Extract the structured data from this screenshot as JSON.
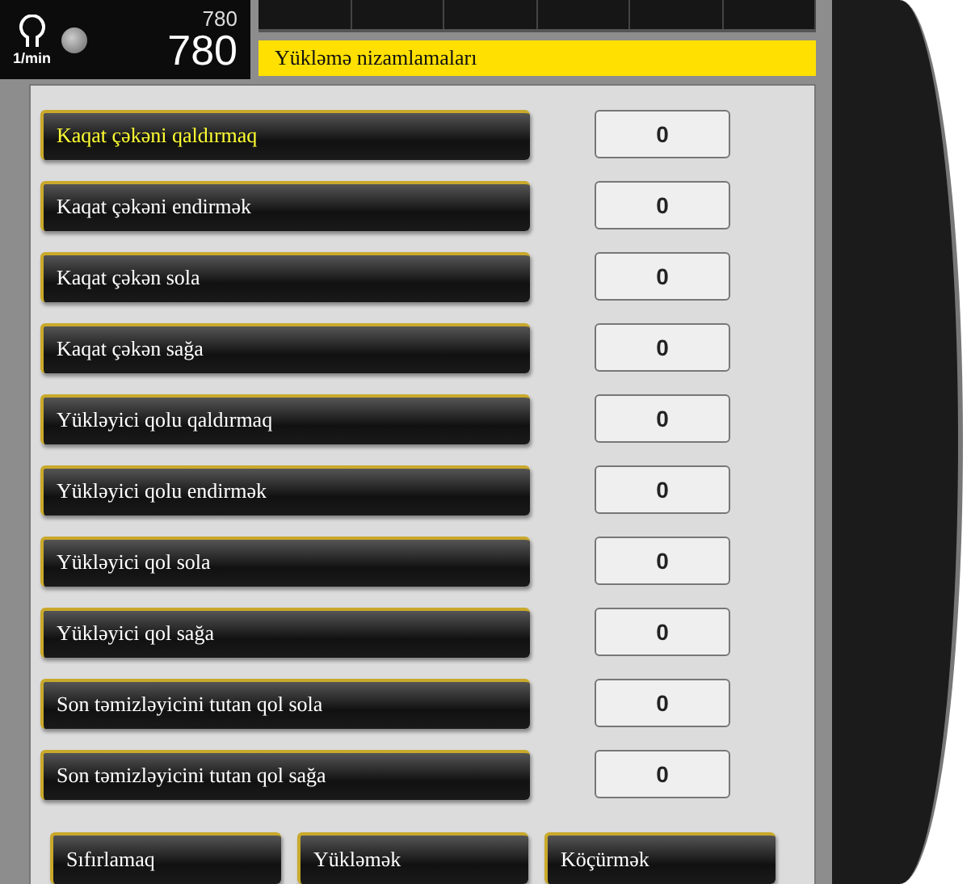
{
  "speed": {
    "unit": "1/min",
    "setpoint": "780",
    "actual": "780"
  },
  "title": "Yükləmə nizamlamaları",
  "rows": [
    {
      "label": "Kaqat çəkəni qaldırmaq",
      "value": "0",
      "selected": true
    },
    {
      "label": "Kaqat çəkəni endirmək",
      "value": "0",
      "selected": false
    },
    {
      "label": "Kaqat çəkən sola",
      "value": "0",
      "selected": false
    },
    {
      "label": "Kaqat çəkən sağa",
      "value": "0",
      "selected": false
    },
    {
      "label": "Yükləyici qolu qaldırmaq",
      "value": "0",
      "selected": false
    },
    {
      "label": "Yükləyici qolu endirmək",
      "value": "0",
      "selected": false
    },
    {
      "label": "Yükləyici qol sola",
      "value": "0",
      "selected": false
    },
    {
      "label": "Yükləyici qol sağa",
      "value": "0",
      "selected": false
    },
    {
      "label": "Son təmizləyicini tutan qol sola",
      "value": "0",
      "selected": false
    },
    {
      "label": "Son təmizləyicini tutan qol sağa",
      "value": "0",
      "selected": false
    }
  ],
  "buttons": [
    "Sıfırlamaq",
    "Yükləmək",
    "Köçürmək"
  ]
}
